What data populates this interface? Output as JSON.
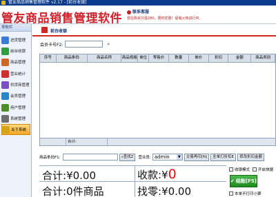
{
  "window": {
    "title": "管友商品销售管理软件 v2.17 - [前台收银]"
  },
  "header": {
    "brand": "管友商品销售管理软件",
    "contact": "联系客服",
    "notice": "现在购买只需280，限时优惠！促销火热进行中。"
  },
  "sidebar": {
    "heading": "导航栏",
    "items": [
      {
        "label": "进货管理",
        "icon": "truck-icon",
        "color": "#3a7bd5"
      },
      {
        "label": "前台收银",
        "icon": "cash-register-icon",
        "color": "#2e9e3e"
      },
      {
        "label": "商品管理",
        "icon": "box-icon",
        "color": "#d0672a"
      },
      {
        "label": "营业统计",
        "icon": "chart-icon",
        "color": "#c8332a"
      },
      {
        "label": "供货商管理",
        "icon": "supplier-icon",
        "color": "#7a4fc2"
      },
      {
        "label": "会员管理",
        "icon": "member-icon",
        "color": "#2b86c9"
      },
      {
        "label": "用户管理",
        "icon": "user-icon",
        "color": "#4a8f2a"
      },
      {
        "label": "系统管理",
        "icon": "gear-icon",
        "color": "#6e6e6e"
      },
      {
        "label": "关于系统",
        "icon": "info-icon",
        "color": "#d8a21a"
      }
    ],
    "active_index": 8
  },
  "panel": {
    "title": "前台收银"
  },
  "member": {
    "label": "会员卡号F2:",
    "value": ""
  },
  "grid": {
    "columns": [
      "序号",
      "商品条码",
      "商品名称",
      "商品规格",
      "单位",
      "零售价",
      "数量",
      "单价",
      "折扣",
      "金额",
      "商品类别"
    ],
    "footer_label": "合计:"
  },
  "scan": {
    "label": "商品条码F1:",
    "find_label": "查找Z",
    "salesman_label": "营业员:",
    "salesman_value": "admin",
    "reprint_label": "交易再印[N]",
    "fullprint_label": "全单打折扣E",
    "edit_discount_label": "修改折扣金额"
  },
  "totals": {
    "sum_label": "合计:",
    "sum_value": "¥0.00",
    "received_label": "收款:",
    "received_prefix": "¥",
    "received_value": "0",
    "count_label": "合计:",
    "count_value": "0件商品",
    "change_label": "找零:",
    "change_value": "¥0.00"
  },
  "options": {
    "cash_mode": "收银模式",
    "quick_settle": "开启快捷",
    "settle_label": "结账[F5]",
    "print_receipt": "本单不打印小票"
  }
}
